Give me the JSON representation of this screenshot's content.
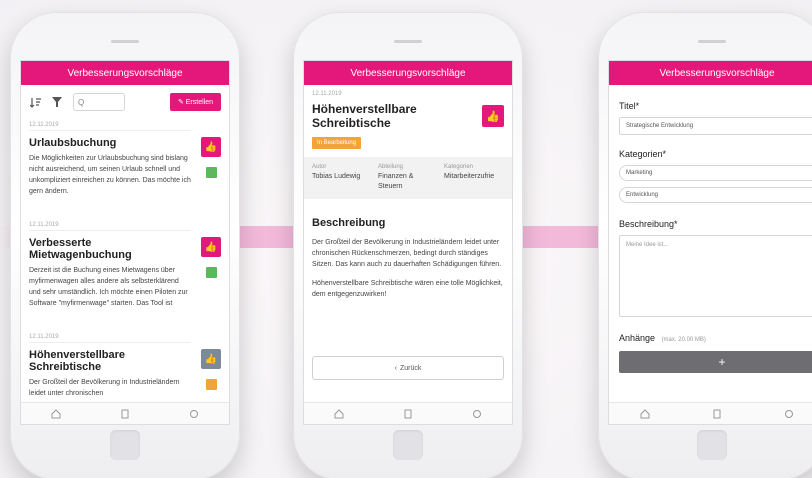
{
  "screen1": {
    "header": "Verbesserungsvorschläge",
    "search_placeholder": "Q",
    "create_label": "✎ Erstellen",
    "cards": [
      {
        "date": "12.11.2019",
        "title": "Urlaubsbuchung",
        "text": "Die Möglichkeiten zur Urlaubsbuchung sind bislang nicht ausreichend, um seinen Urlaub schnell und unkompliziert einreichen zu können. Das möchte ich gern ändern.",
        "status_color": "#5cb85c"
      },
      {
        "date": "12.11.2019",
        "title": "Verbesserte Mietwagenbuchung",
        "text": "Derzeit ist die Buchung eines Mietwagens über myfirmenwagen alles andere als selbsterklärend und sehr umständlich. Ich möchte einen Piloten zur Software \"myfirmenwage\" starten. Das Tool ist",
        "status_color": "#5cb85c"
      },
      {
        "date": "12.11.2019",
        "title": "Höhenverstellbare Schreibtische",
        "text": "Der Großteil der Bevölkerung in Industrieländern leidet unter chronischen",
        "status_color": "#f2a33a"
      }
    ]
  },
  "screen2": {
    "header": "Verbesserungsvorschläge",
    "date": "12.11.2019",
    "title": "Höhenverstellbare Schreibtische",
    "badge": "In Bearbeitung",
    "meta": [
      {
        "key": "Autor",
        "value": "Tobias Ludewig"
      },
      {
        "key": "Abteilung",
        "value": "Finanzen & Steuern"
      },
      {
        "key": "Kategorien",
        "value": "Mitarbeiterzufrie"
      }
    ],
    "desc_heading": "Beschreibung",
    "desc_p1": "Der Großteil der Bevölkerung in Industrieländern leidet unter chronischen Rückenschmerzen, bedingt durch ständiges Sitzen. Das kann auch zu dauerhaften Schädigungen führen.",
    "desc_p2": "Höhenverstellbare Schreibtische wären eine tolle Möglichkeit, dem entgegenzuwirken!",
    "back_label": "Zurück"
  },
  "screen3": {
    "header": "Verbesserungsvorschläge",
    "title_label": "Titel*",
    "title_value": "Strategische Entwicklung",
    "categories_label": "Kategorien*",
    "category_1": "Marketing",
    "category_2": "Entwicklung",
    "description_label": "Beschreibung*",
    "description_placeholder": "Meine Idee ist...",
    "attachments_label": "Anhänge",
    "attachments_hint": "(max. 20.00 MB)",
    "add_label": "+"
  },
  "colors": {
    "brand": "#e4187a",
    "like_grey": "#7a8a99",
    "in_progress": "#f2a33a",
    "add_button": "#6d6d72"
  }
}
